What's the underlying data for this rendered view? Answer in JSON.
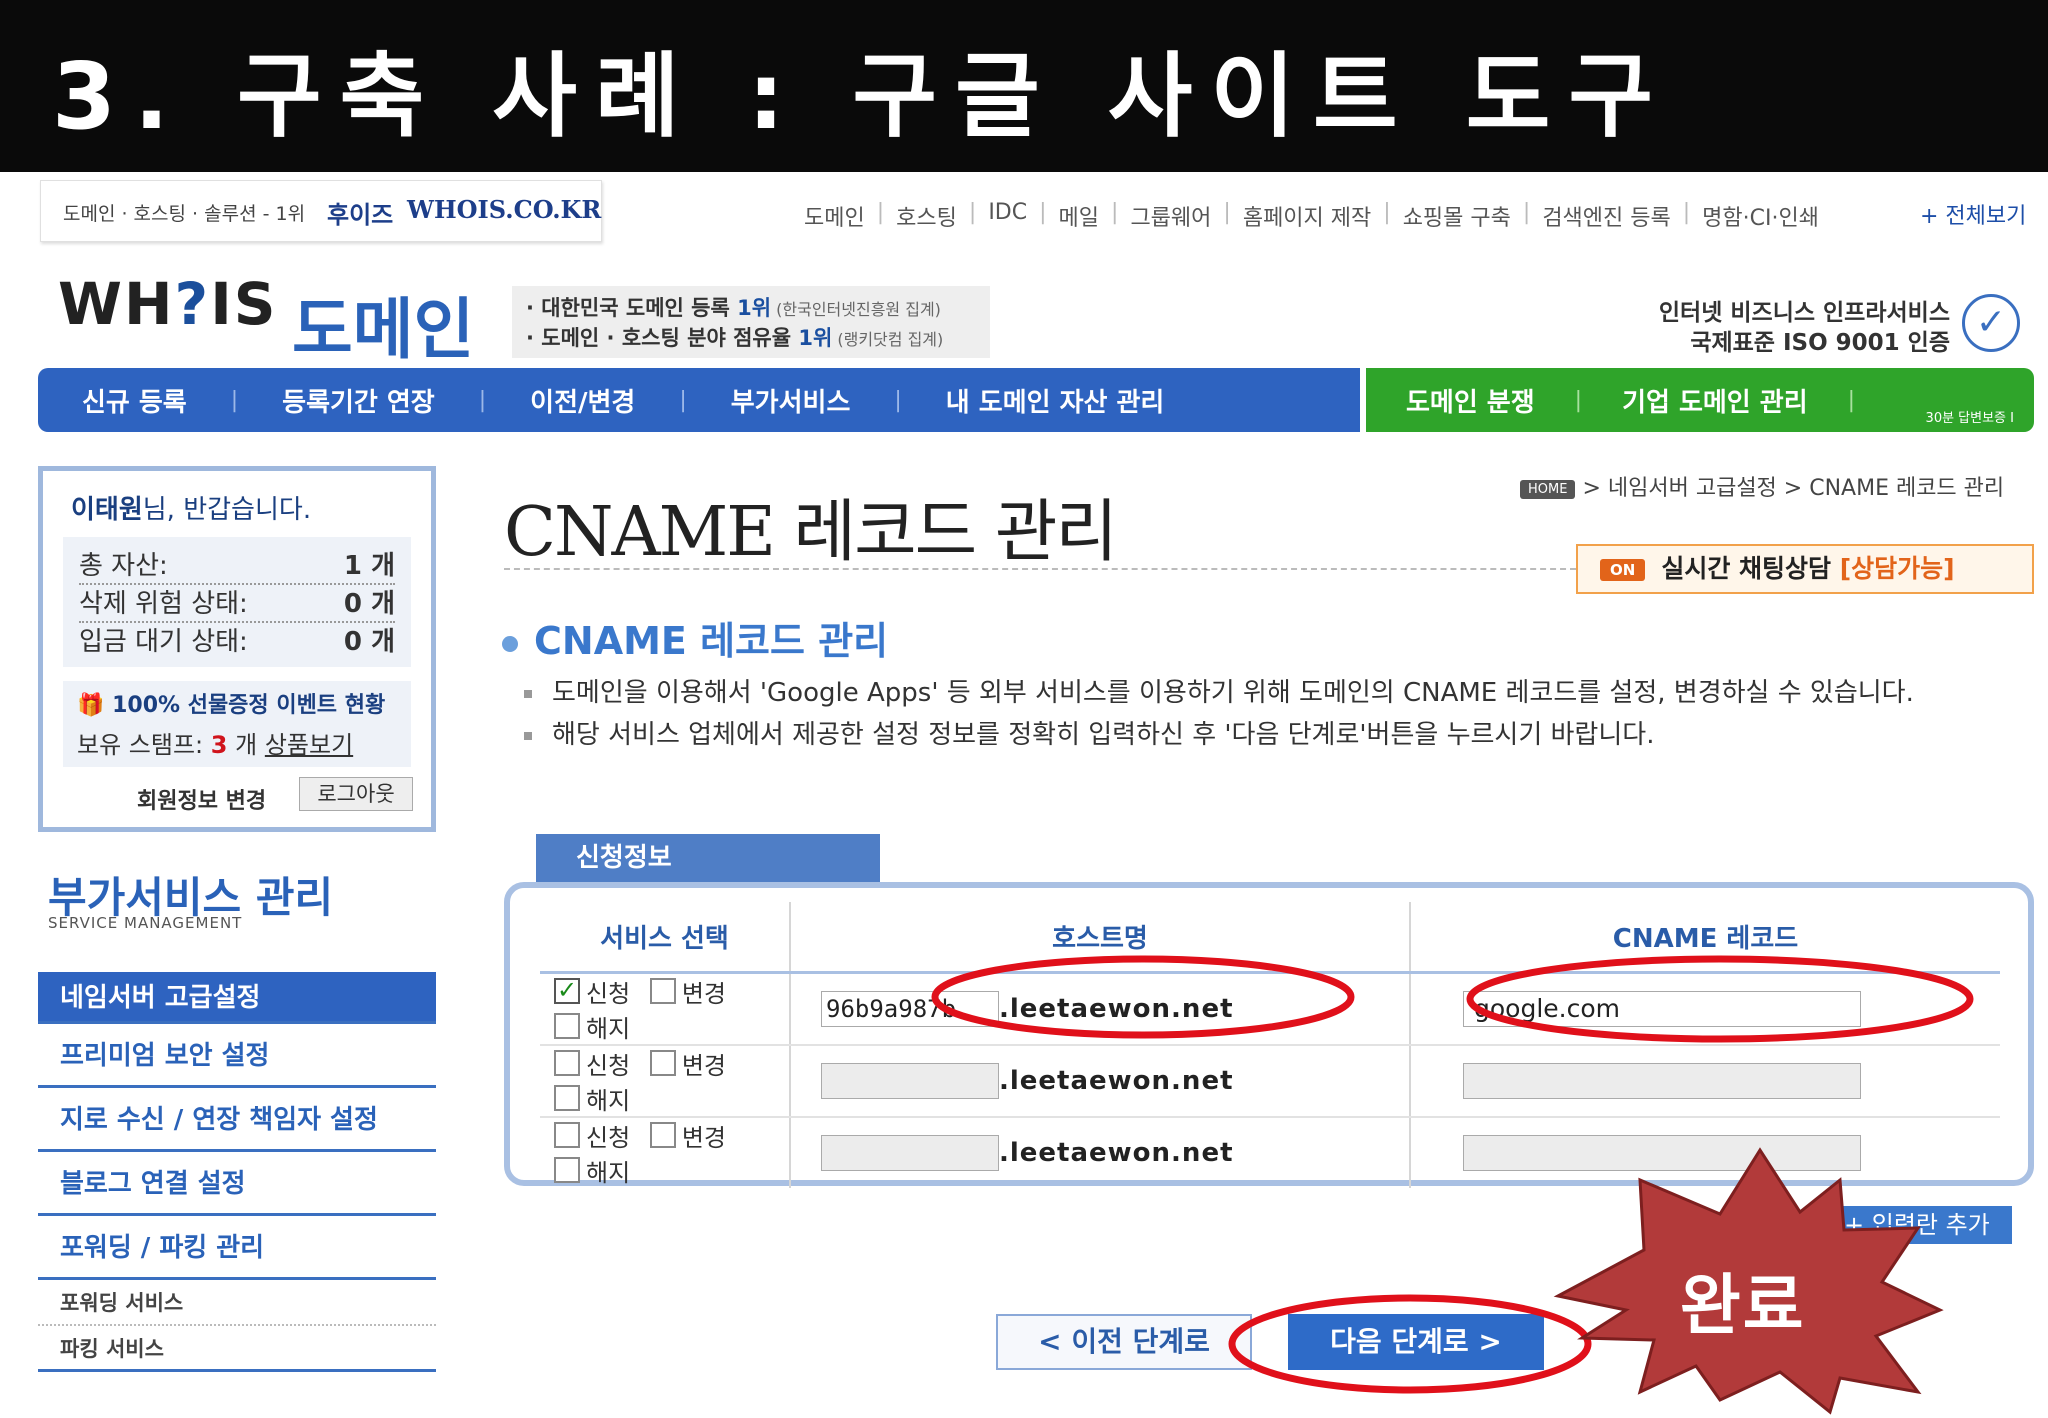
{
  "slide": {
    "title": "3. 구축 사례 : 구글 사이트 도구"
  },
  "topbar": {
    "tagline": "도메인 · 호스팅 · 솔루션 - 1위",
    "brand_kr": "후이즈",
    "brand_en": "WHOIS.CO.KR",
    "nav": [
      "도메인",
      "호스팅",
      "IDC",
      "메일",
      "그룹웨어",
      "홈페이지 제작",
      "쇼핑몰 구축",
      "검색엔진 등록",
      "명함·CI·인쇄"
    ],
    "view_all": "+ 전체보기"
  },
  "logo": {
    "text_a": "WH",
    "text_q": "?",
    "text_b": "IS",
    "domain": "도메인"
  },
  "rank": {
    "line1_a": "· 대한민국 도메인 등록 ",
    "line1_rank": "1위",
    "line1_note": " (한국인터넷진흥원 집계)",
    "line2_a": "· 도메인 · 호스팅 분야 점유율 ",
    "line2_rank": "1위",
    "line2_note": " (랭키닷컴 집계)"
  },
  "iso": {
    "line1": "인터넷 비즈니스 인프라서비스",
    "line2": "국제표준 ISO 9001 인증"
  },
  "mainnav": {
    "items": [
      "신규 등록",
      "등록기간 연장",
      "이전/변경",
      "부가서비스",
      "내 도메인 자산 관리"
    ]
  },
  "greennav": {
    "items": [
      "도메인 분쟁",
      "기업 도메인 관리"
    ],
    "tiny": "30분 답변보증 I"
  },
  "user": {
    "name": "이태원",
    "greet_suffix": "님, 반갑습니다.",
    "stats": [
      {
        "label": "총 자산:",
        "value": "1",
        "unit": "개"
      },
      {
        "label": "삭제 위험 상태:",
        "value": "0",
        "unit": "개"
      },
      {
        "label": "입금 대기 상태:",
        "value": "0",
        "unit": "개"
      }
    ],
    "event_title": "100% 선물증정 이벤트 현황",
    "stamp_label": "보유 스탬프:",
    "stamp_count": "3",
    "stamp_unit": "개",
    "stamp_link": "상품보기",
    "edit_info": "회원정보 변경",
    "logout": "로그아웃"
  },
  "sidebar": {
    "title": "부가서비스 관리",
    "subtitle": "SERVICE MANAGEMENT",
    "items": [
      "네임서버 고급설정",
      "프리미엄 보안 설정",
      "지로 수신 / 연장 책임자 설정",
      "블로그 연결 설정",
      "포워딩 / 파킹 관리"
    ],
    "subitems": [
      "포워딩 서비스",
      "파킹 서비스"
    ]
  },
  "content": {
    "title": "CNAME 레코드 관리",
    "breadcrumb_home": "HOME",
    "breadcrumb": "> 네임서버 고급설정 > CNAME 레코드 관리",
    "chat_on": "ON",
    "chat_text": "실시간 채팅상담 ",
    "chat_avail": "[상담가능]",
    "section": "CNAME 레코드 관리",
    "desc1": "도메인을 이용해서 'Google Apps' 등 외부 서비스를 이용하기 위해 도메인의 CNAME 레코드를 설정, 변경하실 수 있습니다.",
    "desc2": "해당 서비스 업체에서 제공한 설정 정보를 정확히 입력하신 후 '다음 단계로'버튼을 누르시기 바랍니다.",
    "tab": "신청정보"
  },
  "table": {
    "headers": [
      "서비스 선택",
      "호스트명",
      "CNAME 레코드"
    ],
    "options": [
      "신청",
      "변경",
      "해지"
    ],
    "suffix": ".leetaewon.net",
    "rows": [
      {
        "apply": true,
        "host": "96b9a987b",
        "cname": "google.com"
      },
      {
        "apply": false,
        "host": "",
        "cname": ""
      },
      {
        "apply": false,
        "host": "",
        "cname": ""
      }
    ],
    "add_row": "+ 입력란 추가"
  },
  "buttons": {
    "prev": "< 이전 단계로",
    "next": "다음 단계로 >"
  },
  "annotation": {
    "done": "완료",
    "highlight_color": "#e0101a",
    "burst_color": "#b23a3a"
  }
}
